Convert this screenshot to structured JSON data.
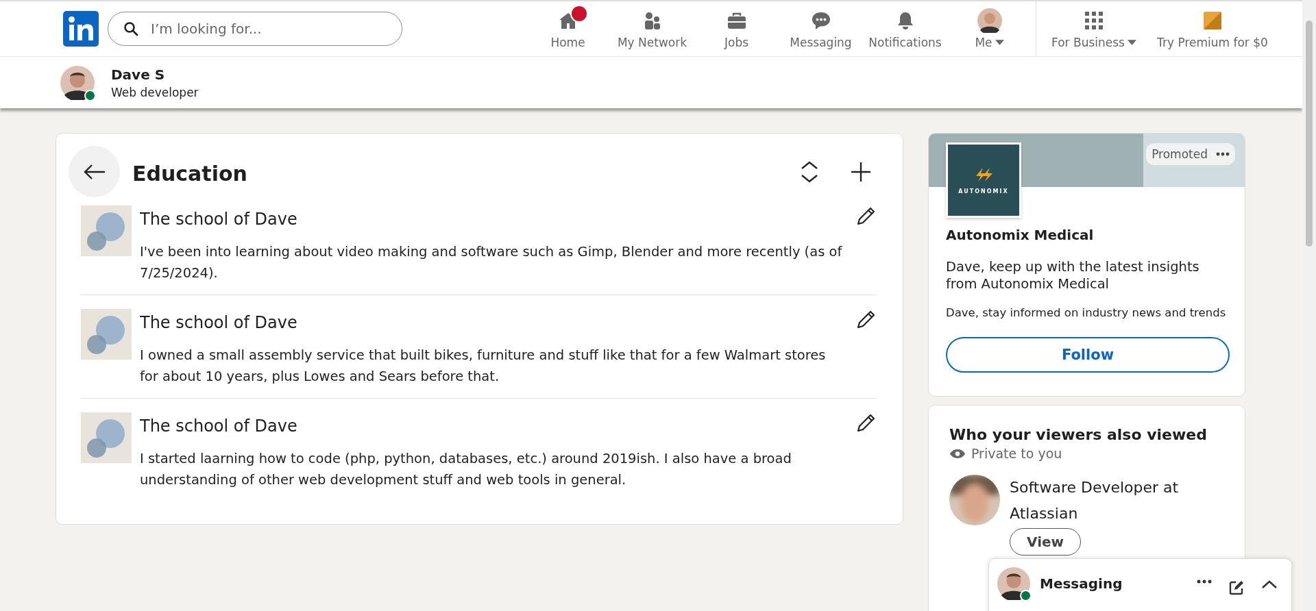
{
  "nav": {
    "search": {
      "placeholder": "I’m looking for..."
    },
    "items": [
      {
        "kind": "home",
        "label": "Home",
        "badge": true,
        "caret": false
      },
      {
        "kind": "network",
        "label": "My Network",
        "badge": false,
        "caret": false
      },
      {
        "kind": "jobs",
        "label": "Jobs",
        "badge": false,
        "caret": false
      },
      {
        "kind": "messaging",
        "label": "Messaging",
        "badge": false,
        "caret": false
      },
      {
        "kind": "notifications",
        "label": "Notifications",
        "badge": false,
        "caret": false
      },
      {
        "kind": "me",
        "label": "Me",
        "badge": false,
        "caret": true
      },
      {
        "kind": "apps",
        "label": "For Business",
        "badge": false,
        "caret": true
      },
      {
        "kind": "premium",
        "label": "Try Premium for $0",
        "badge": false,
        "caret": false
      }
    ]
  },
  "profile": {
    "name": "Dave S",
    "headline": "Web developer",
    "online": true
  },
  "education": {
    "title": "Education",
    "items": [
      {
        "school": "The school of Dave",
        "description": "I've been into learning about video making and software such as Gimp, Blender and more recently (as of 7/25/2024)."
      },
      {
        "school": "The school of Dave",
        "description": "I owned a small assembly service that built bikes, furniture and stuff like that for a few Walmart stores for about 10 years, plus Lowes and Sears before that."
      },
      {
        "school": "The school of Dave",
        "description": "I started laarning how to code (php, python, databases, etc.) around 2019ish. I also have a broad understanding of other web development stuff and web tools in general."
      }
    ]
  },
  "ad": {
    "badge": "Promoted",
    "logo_text": "AUTONOMIX",
    "company": "Autonomix Medical",
    "headline": "Dave, keep up with the latest insights from Autonomix Medical",
    "subtext": "Dave, stay informed on industry news and trends",
    "button": "Follow"
  },
  "viewers": {
    "title": "Who your viewers also viewed",
    "privacy": "Private to you",
    "people": [
      {
        "title": "Software Developer at Atlassian",
        "button": "View"
      }
    ]
  },
  "messaging": {
    "title": "Messaging",
    "online": true
  }
}
